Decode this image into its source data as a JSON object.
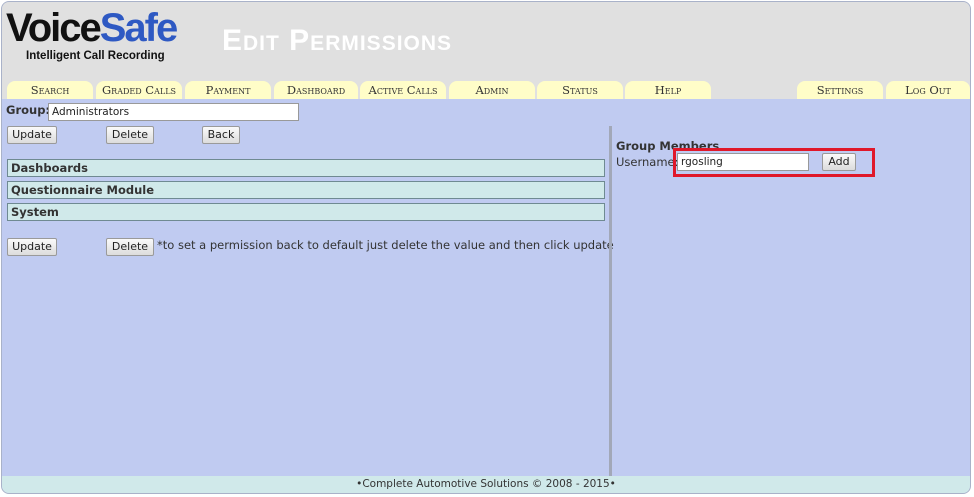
{
  "logo": {
    "brand_part1": "Voice",
    "brand_part2": "Safe",
    "tagline": "Intelligent Call Recording"
  },
  "page_title": "Edit Permissions",
  "nav": {
    "tabs": [
      "Search",
      "Graded Calls",
      "Payment",
      "Dashboard",
      "Active Calls",
      "Admin",
      "Status",
      "Help"
    ],
    "right_tabs": [
      "Settings",
      "Log Out"
    ]
  },
  "group": {
    "label": "Group:",
    "value": "Administrators"
  },
  "actions_top": {
    "update_label": "Update",
    "delete_label": "Delete",
    "back_label": "Back"
  },
  "sections": [
    "Dashboards",
    "Questionnaire Module",
    "System"
  ],
  "actions_bottom": {
    "update_label": "Update",
    "delete_label": "Delete",
    "note": "*to set a permission back to default just delete the value and then click update"
  },
  "members": {
    "heading": "Group Members",
    "username_label": "Username:",
    "username_value": "rgosling",
    "add_label": "Add"
  },
  "footer": {
    "text": "•Complete Automotive Solutions © 2008 - 2015•"
  },
  "colors": {
    "background": "#c0cbf1",
    "header": "#e0e0e0",
    "tab": "#fffdc8",
    "section": "#d0e9ea",
    "brand_accent": "#2e59c3",
    "highlight": "#e0182a"
  }
}
